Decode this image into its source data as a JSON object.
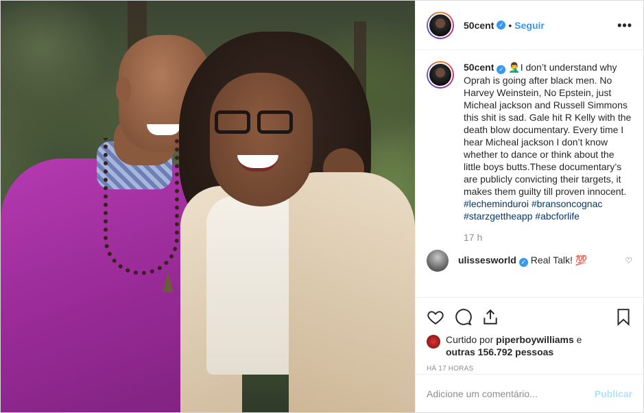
{
  "header": {
    "username": "50cent",
    "separator": "•",
    "follow_label": "Seguir",
    "more_label": "•••"
  },
  "caption": {
    "username": "50cent",
    "emoji": "🤦‍♂️",
    "text": "I don’t understand why Oprah is going after black men. No Harvey Weinstein, No Epstein, just Micheal jackson and Russell Simmons this shit is sad. Gale hit R Kelly with the death blow documentary. Every time I hear Micheal jackson I don’t know whether to dance or think about the little boys butts.These documentary’s are publicly convicting their targets, it makes them guilty till proven innocent.",
    "hashtags": [
      "#lecheminduroi",
      "#bransoncognac",
      "#starzgettheapp",
      "#abcforlife"
    ],
    "time": "17 h"
  },
  "reply": {
    "username": "ulissesworld",
    "text": "Real Talk! 💯"
  },
  "likes": {
    "prefix": "Curtido por",
    "user": "piperboywilliams",
    "conj": "e",
    "others": "outras 156.792 pessoas"
  },
  "posted_ago": "HÁ 17 HORAS",
  "comment_box": {
    "placeholder": "Adicione um comentário...",
    "publish_label": "Publicar"
  },
  "colors": {
    "accent": "#3897f0",
    "publish_disabled": "#b2dffc",
    "hashtag": "#00376b",
    "muted": "#8e8e8e"
  },
  "icons": [
    "verified-badge-icon",
    "more-icon",
    "heart-icon",
    "comment-icon",
    "share-icon",
    "bookmark-icon",
    "heart-small-icon"
  ]
}
